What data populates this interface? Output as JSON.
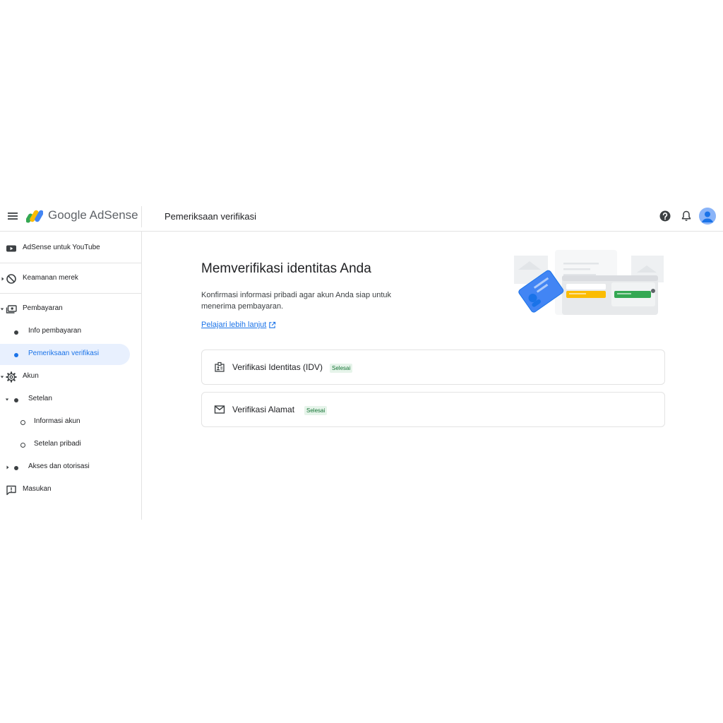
{
  "header": {
    "brand_google": "Google",
    "brand_product": "AdSense",
    "page_title": "Pemeriksaan verifikasi"
  },
  "sidebar": {
    "items": [
      {
        "label": "AdSense untuk YouTube",
        "icon": "youtube-icon"
      },
      {
        "label": "Keamanan merek",
        "icon": "block-icon"
      },
      {
        "label": "Pembayaran",
        "icon": "payments-icon"
      },
      {
        "label": "Info pembayaran"
      },
      {
        "label": "Pemeriksaan verifikasi",
        "active": true
      },
      {
        "label": "Akun",
        "icon": "gear-icon"
      },
      {
        "label": "Setelan"
      },
      {
        "label": "Informasi akun"
      },
      {
        "label": "Setelan pribadi"
      },
      {
        "label": "Akses dan otorisasi"
      },
      {
        "label": "Masukan",
        "icon": "feedback-icon"
      }
    ]
  },
  "main": {
    "title": "Memverifikasi identitas Anda",
    "description": "Konfirmasi informasi pribadi agar akun Anda siap untuk menerima pembayaran.",
    "learn_more": "Pelajari lebih lanjut",
    "cards": [
      {
        "title": "Verifikasi Identitas (IDV)",
        "status": "Selesai",
        "icon": "id-badge-icon"
      },
      {
        "title": "Verifikasi Alamat",
        "status": "Selesai",
        "icon": "mail-icon"
      }
    ]
  },
  "colors": {
    "accent": "#1a73e8",
    "active_bg": "#e8f0fe",
    "badge_bg": "#e6f4ea",
    "badge_text": "#137333"
  }
}
